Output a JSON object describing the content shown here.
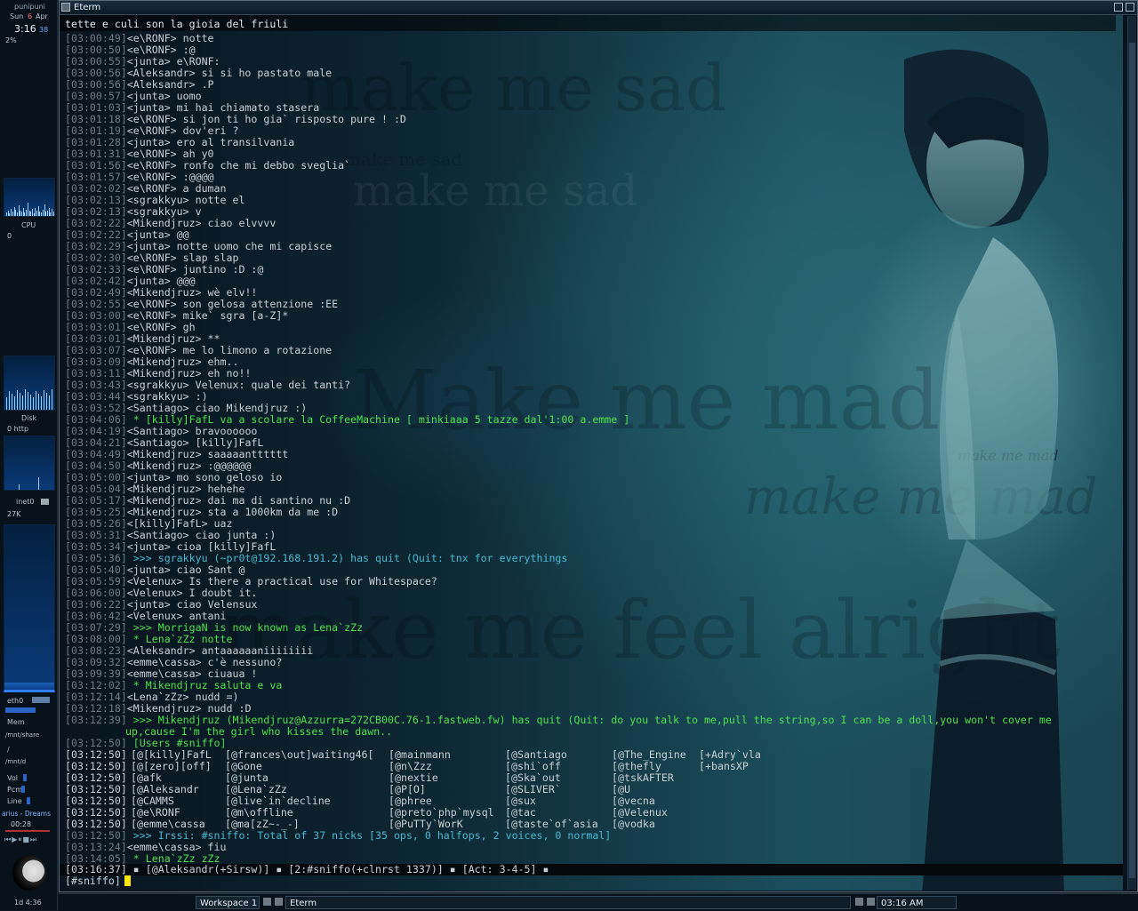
{
  "dock": {
    "host": "punipuni",
    "day": "Sun",
    "date": "6",
    "month": "Apr",
    "time": "3:16",
    "seconds": "38",
    "load": "2%",
    "cpu_label": "CPU",
    "cpu_value": "0",
    "disk_label": "Disk",
    "disk_value": "0 http",
    "net_label": "inet0",
    "net_value": "27K",
    "eth_label": "eth0",
    "mem_label": "Mem",
    "mounts": [
      "/mnt/share",
      "/",
      "/mnt/d"
    ],
    "vol_label": "Vol",
    "pcm_label": "Pcm",
    "line_label": "Line",
    "track": "arius - Dreams",
    "track_time": "00:28",
    "moon_label": "1d 4:36"
  },
  "window": {
    "title": "Eterm"
  },
  "terminal": {
    "topic": "tette e culi son la gioia del friuli",
    "lines": [
      {
        "t": "[03:00:49]",
        "n": "<e\\RONF>",
        "m": " notte"
      },
      {
        "t": "[03:00:50]",
        "n": "<e\\RONF>",
        "m": " :@"
      },
      {
        "t": "[03:00:55]",
        "n": "<junta>",
        "m": " e\\RONF:"
      },
      {
        "t": "[03:00:56]",
        "n": "<Aleksandr>",
        "m": " si si ho pastato male"
      },
      {
        "t": "[03:00:56]",
        "n": "<Aleksandr>",
        "m": " .P"
      },
      {
        "t": "[03:00:57]",
        "n": "<junta>",
        "m": " uomo"
      },
      {
        "t": "[03:01:03]",
        "n": "<junta>",
        "m": " mi hai chiamato stasera"
      },
      {
        "t": "[03:01:18]",
        "n": "<e\\RONF>",
        "m": " si jon ti ho gia` risposto pure ! :D"
      },
      {
        "t": "[03:01:19]",
        "n": "<e\\RONF>",
        "m": " dov'eri ?"
      },
      {
        "t": "[03:01:28]",
        "n": "<junta>",
        "m": " ero al transilvania"
      },
      {
        "t": "[03:01:31]",
        "n": "<e\\RONF>",
        "m": " ah y0"
      },
      {
        "t": "[03:01:56]",
        "n": "<e\\RONF>",
        "m": " ronfo che mi debbo sveglia`"
      },
      {
        "t": "[03:01:57]",
        "n": "<e\\RONF>",
        "m": " :@@@@"
      },
      {
        "t": "[03:02:02]",
        "n": "<e\\RONF>",
        "m": " a duman"
      },
      {
        "t": "[03:02:13]",
        "n": "<sgrakkyu>",
        "m": " notte el"
      },
      {
        "t": "[03:02:13]",
        "n": "<sgrakkyu>",
        "m": " v"
      },
      {
        "t": "[03:02:22]",
        "n": "<Mikendjruz>",
        "m": " ciao elvvvv"
      },
      {
        "t": "[03:02:22]",
        "n": "<junta>",
        "m": " @@"
      },
      {
        "t": "[03:02:29]",
        "n": "<junta>",
        "m": " notte uomo che mi capisce"
      },
      {
        "t": "[03:02:30]",
        "n": "<e\\RONF>",
        "m": " slap slap"
      },
      {
        "t": "[03:02:33]",
        "n": "<e\\RONF>",
        "m": " juntino :D :@"
      },
      {
        "t": "[03:02:42]",
        "n": "<junta>",
        "m": " @@@"
      },
      {
        "t": "[03:02:49]",
        "n": "<Mikendjruz>",
        "m": " wè elv!!"
      },
      {
        "t": "[03:02:55]",
        "n": "<e\\RONF>",
        "m": " son gelosa attenzione :EE"
      },
      {
        "t": "[03:03:00]",
        "n": "<e\\RONF>",
        "m": " mike` sgra [a-Z]*"
      },
      {
        "t": "[03:03:01]",
        "n": "<e\\RONF>",
        "m": " gh"
      },
      {
        "t": "[03:03:01]",
        "n": "<Mikendjruz>",
        "m": " **"
      },
      {
        "t": "[03:03:07]",
        "n": "<e\\RONF>",
        "m": " me lo limono a rotazione"
      },
      {
        "t": "[03:03:09]",
        "n": "<Mikendjruz>",
        "m": " ehm.."
      },
      {
        "t": "[03:03:11]",
        "n": "<Mikendjruz>",
        "m": " eh no!!"
      },
      {
        "t": "[03:03:43]",
        "n": "<sgrakkyu>",
        "m": " Velenux: quale dei tanti?"
      },
      {
        "t": "[03:03:44]",
        "n": "<sgrakkyu>",
        "m": " :)"
      },
      {
        "t": "[03:03:52]",
        "n": "<Santiago>",
        "m": " ciao Mikendjruz :)"
      },
      {
        "t": "[03:04:06]",
        "n": "",
        "m": " * [killy]FafL va a scolare la CoffeeMachine [ minkiaaa 5 tazze dal'1:00 a.emme ]",
        "c": "green"
      },
      {
        "t": "[03:04:19]",
        "n": "<Santiago>",
        "m": " bravoooooo"
      },
      {
        "t": "[03:04:21]",
        "n": "<Santiago>",
        "m": " [killy]FafL"
      },
      {
        "t": "[03:04:49]",
        "n": "<Mikendjruz>",
        "m": " saaaaantttttt"
      },
      {
        "t": "[03:04:50]",
        "n": "<Mikendjruz>",
        "m": " :@@@@@@"
      },
      {
        "t": "[03:05:00]",
        "n": "<junta>",
        "m": " mo sono geloso io"
      },
      {
        "t": "[03:05:04]",
        "n": "<Mikendjruz>",
        "m": " hehehe"
      },
      {
        "t": "[03:05:17]",
        "n": "<Mikendjruz>",
        "m": " dai ma di santino nu :D"
      },
      {
        "t": "[03:05:25]",
        "n": "<Mikendjruz>",
        "m": " sta a 1000km da me :D"
      },
      {
        "t": "[03:05:26]",
        "n": "<[killy]FafL>",
        "m": " uaz"
      },
      {
        "t": "[03:05:31]",
        "n": "<Santiago>",
        "m": " ciao junta :)"
      },
      {
        "t": "[03:05:34]",
        "n": "<junta>",
        "m": " cioa [killy]FafL"
      },
      {
        "t": "[03:05:36]",
        "n": "",
        "m": " >>> sgrakkyu (~pr0t@192.168.191.2) has quit (Quit: tnx for everythings",
        "c": "cyan"
      },
      {
        "t": "[03:05:40]",
        "n": "<junta>",
        "m": " ciao Sant @"
      },
      {
        "t": "[03:05:59]",
        "n": "<Velenux>",
        "m": " Is there a practical use for Whitespace?"
      },
      {
        "t": "[03:06:00]",
        "n": "<Velenux>",
        "m": " I doubt it."
      },
      {
        "t": "[03:06:22]",
        "n": "<junta>",
        "m": " ciao Velensux"
      },
      {
        "t": "[03:06:42]",
        "n": "<Velenux>",
        "m": " antani"
      },
      {
        "t": "[03:07:29]",
        "n": "",
        "m": " >>> MorrigaN is now known as Lena`zZz",
        "c": "green"
      },
      {
        "t": "[03:08:00]",
        "n": "",
        "m": " * Lena`zZz notte",
        "c": "green"
      },
      {
        "t": "[03:08:23]",
        "n": "<Aleksandr>",
        "m": " antaaaaaaniiiiiiii"
      },
      {
        "t": "[03:09:32]",
        "n": "<emme\\cassa>",
        "m": " c'è nessuno?"
      },
      {
        "t": "[03:09:39]",
        "n": "<emme\\cassa>",
        "m": " ciuaua !"
      },
      {
        "t": "[03:12:02]",
        "n": "",
        "m": " * Mikendjruz saluta e va",
        "c": "green"
      },
      {
        "t": "[03:12:14]",
        "n": "<Lena`zZz>",
        "m": " nudd =)"
      },
      {
        "t": "[03:12:18]",
        "n": "<Mikendjruz>",
        "m": " nudd :D"
      },
      {
        "t": "[03:12:39]",
        "n": "",
        "m": " >>> Mikendjruz (Mikendjruz@Azzurra=272CB00C.76-1.fastweb.fw) has quit (Quit: do you talk to me,pull the string,so I can be a doll,you won't cover me",
        "c": "green"
      }
    ],
    "wrap_line": "up,cause I'm the girl who kisses the dawn..",
    "users_header": {
      "t": "[03:12:50]",
      "m": " [Users #sniffo]"
    },
    "names_ts": [
      "[03:12:50]",
      "[03:12:50]",
      "[03:12:50]",
      "[03:12:50]",
      "[03:12:50]",
      "[03:12:50]",
      "[03:12:50]"
    ],
    "names": [
      [
        "[@[killy]FafL",
        "[@frances\\out]waiting46[",
        "[@mainmann",
        "[@Santiago",
        "[@The_Engine",
        "[+Adry`vla"
      ],
      [
        "[@[zero][off]",
        "[@Gone",
        "[@n\\Zzz",
        "[@shi`off",
        "[@thefly",
        "[+bansXP"
      ],
      [
        "[@afk",
        "[@junta",
        "[@nextie",
        "[@Ska`out",
        "[@tskAFTER",
        ""
      ],
      [
        "[@Aleksandr",
        "[@Lena`zZz",
        "[@P[O]",
        "[@SLIVER`",
        "[@U",
        ""
      ],
      [
        "[@CAMMS",
        "[@live`in`decline",
        "[@phree",
        "[@sux",
        "[@vecna",
        ""
      ],
      [
        "[@e\\RONF",
        "[@m\\offline",
        "[@preto`php`mysql",
        "[@tac",
        "[@Velenux",
        ""
      ],
      [
        "[@emme\\cassa",
        "[@ma[zZ~-_-]",
        "[@PuTTy`WorK",
        "[@taste`of`asia",
        "[@vodka",
        ""
      ]
    ],
    "tail": [
      {
        "t": "[03:12:50]",
        "n": "",
        "m": " >>> Irssi: #sniffo: Total of 37 nicks [35 ops, 0 halfops, 2 voices, 0 normal]",
        "c": "cyan"
      },
      {
        "t": "[03:13:24]",
        "n": "<emme\\cassa>",
        "m": " fiu"
      },
      {
        "t": "[03:14:05]",
        "n": "",
        "m": " * Lena`zZz zZz",
        "c": "green"
      }
    ],
    "status": "[03:16:37] ▪ [@Aleksandr(+Sirsw)] ▪ [2:#sniffo(+clnrst 1337)] ▪ [Act: 3-4-5] ▪",
    "input": "[#sniffo]"
  },
  "taskbar": {
    "workspace": "Workspace 1",
    "task": "Eterm",
    "clock": "03:16 AM"
  },
  "colors": {
    "accent": "#4fe04f",
    "cyan": "#47b9d2",
    "cursor": "#ffe600"
  },
  "watermarks": [
    "make me sad",
    "Make me mad",
    "make me mad",
    "make me feel alright"
  ]
}
